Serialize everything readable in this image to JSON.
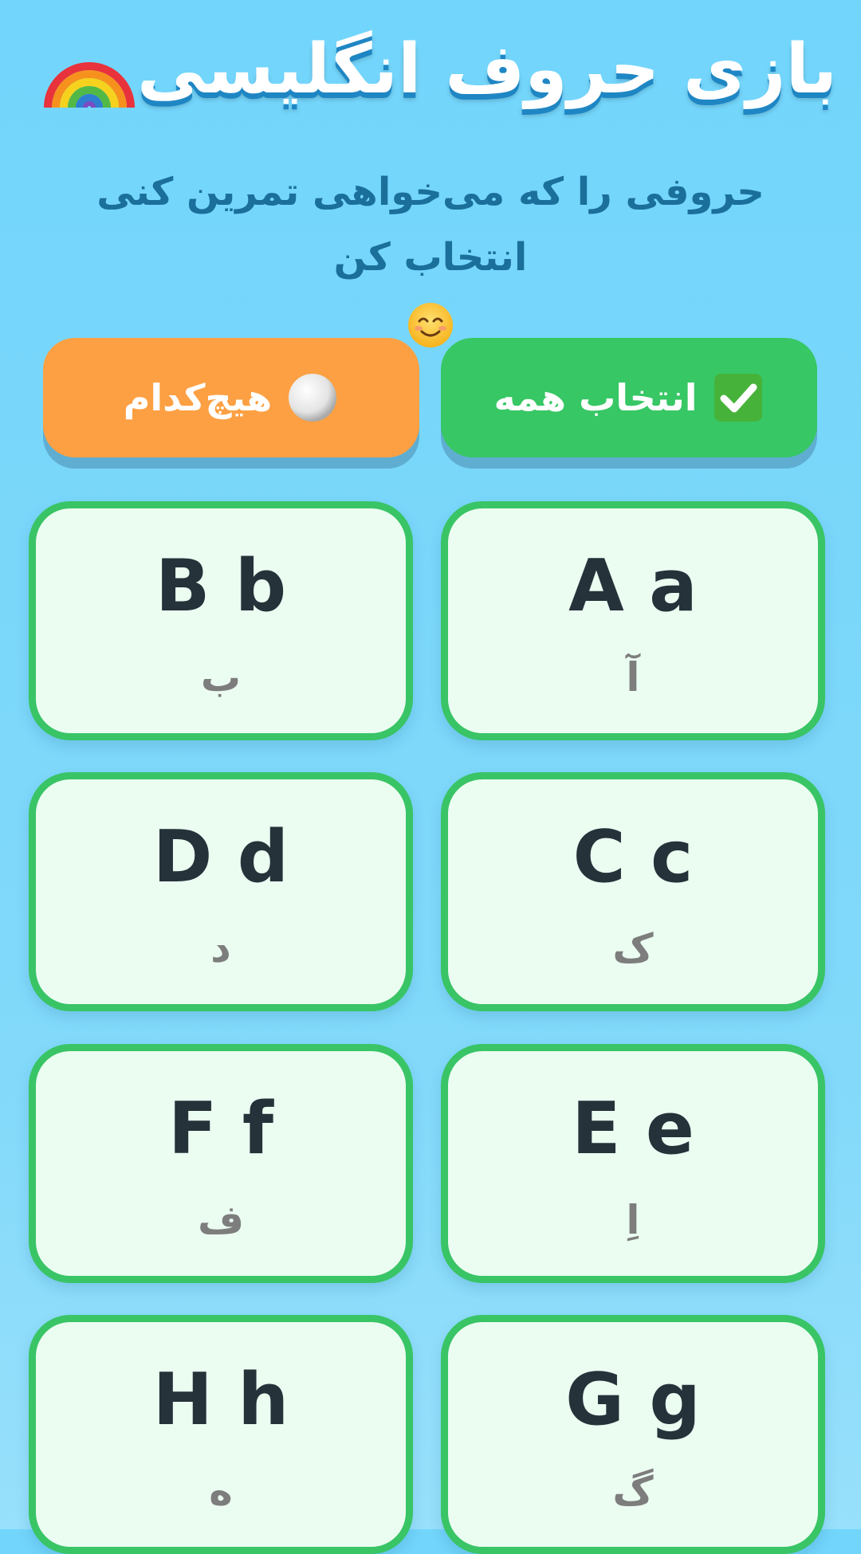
{
  "header": {
    "title": "بازی حروف انگلیسی",
    "title_icon": "rainbow-icon",
    "subtitle": "حروفی را که می‌خواهی تمرین کنی انتخاب کن",
    "subtitle_icon": "smiling-face-icon"
  },
  "actions": {
    "select_all_label": "انتخاب همه",
    "select_all_icon": "check-mark-button-icon",
    "select_none_label": "هیچ‌کدام",
    "select_none_icon": "white-circle-icon"
  },
  "colors": {
    "background": "#72d5fb",
    "select_all": "#37c765",
    "select_none": "#fca043",
    "card_border": "#39c466",
    "card_fill": "#ebfcf1",
    "title_shadow": "#1f86c4",
    "subtitle": "#1a6f9b"
  },
  "letters": [
    {
      "letter": "A a",
      "persian": "آ",
      "selected": true
    },
    {
      "letter": "B b",
      "persian": "ب",
      "selected": true
    },
    {
      "letter": "C c",
      "persian": "ک",
      "selected": true
    },
    {
      "letter": "D d",
      "persian": "د",
      "selected": true
    },
    {
      "letter": "E e",
      "persian": "اِ",
      "selected": true
    },
    {
      "letter": "F f",
      "persian": "ف",
      "selected": true
    },
    {
      "letter": "G g",
      "persian": "گ",
      "selected": true
    },
    {
      "letter": "H h",
      "persian": "ه",
      "selected": true
    }
  ]
}
